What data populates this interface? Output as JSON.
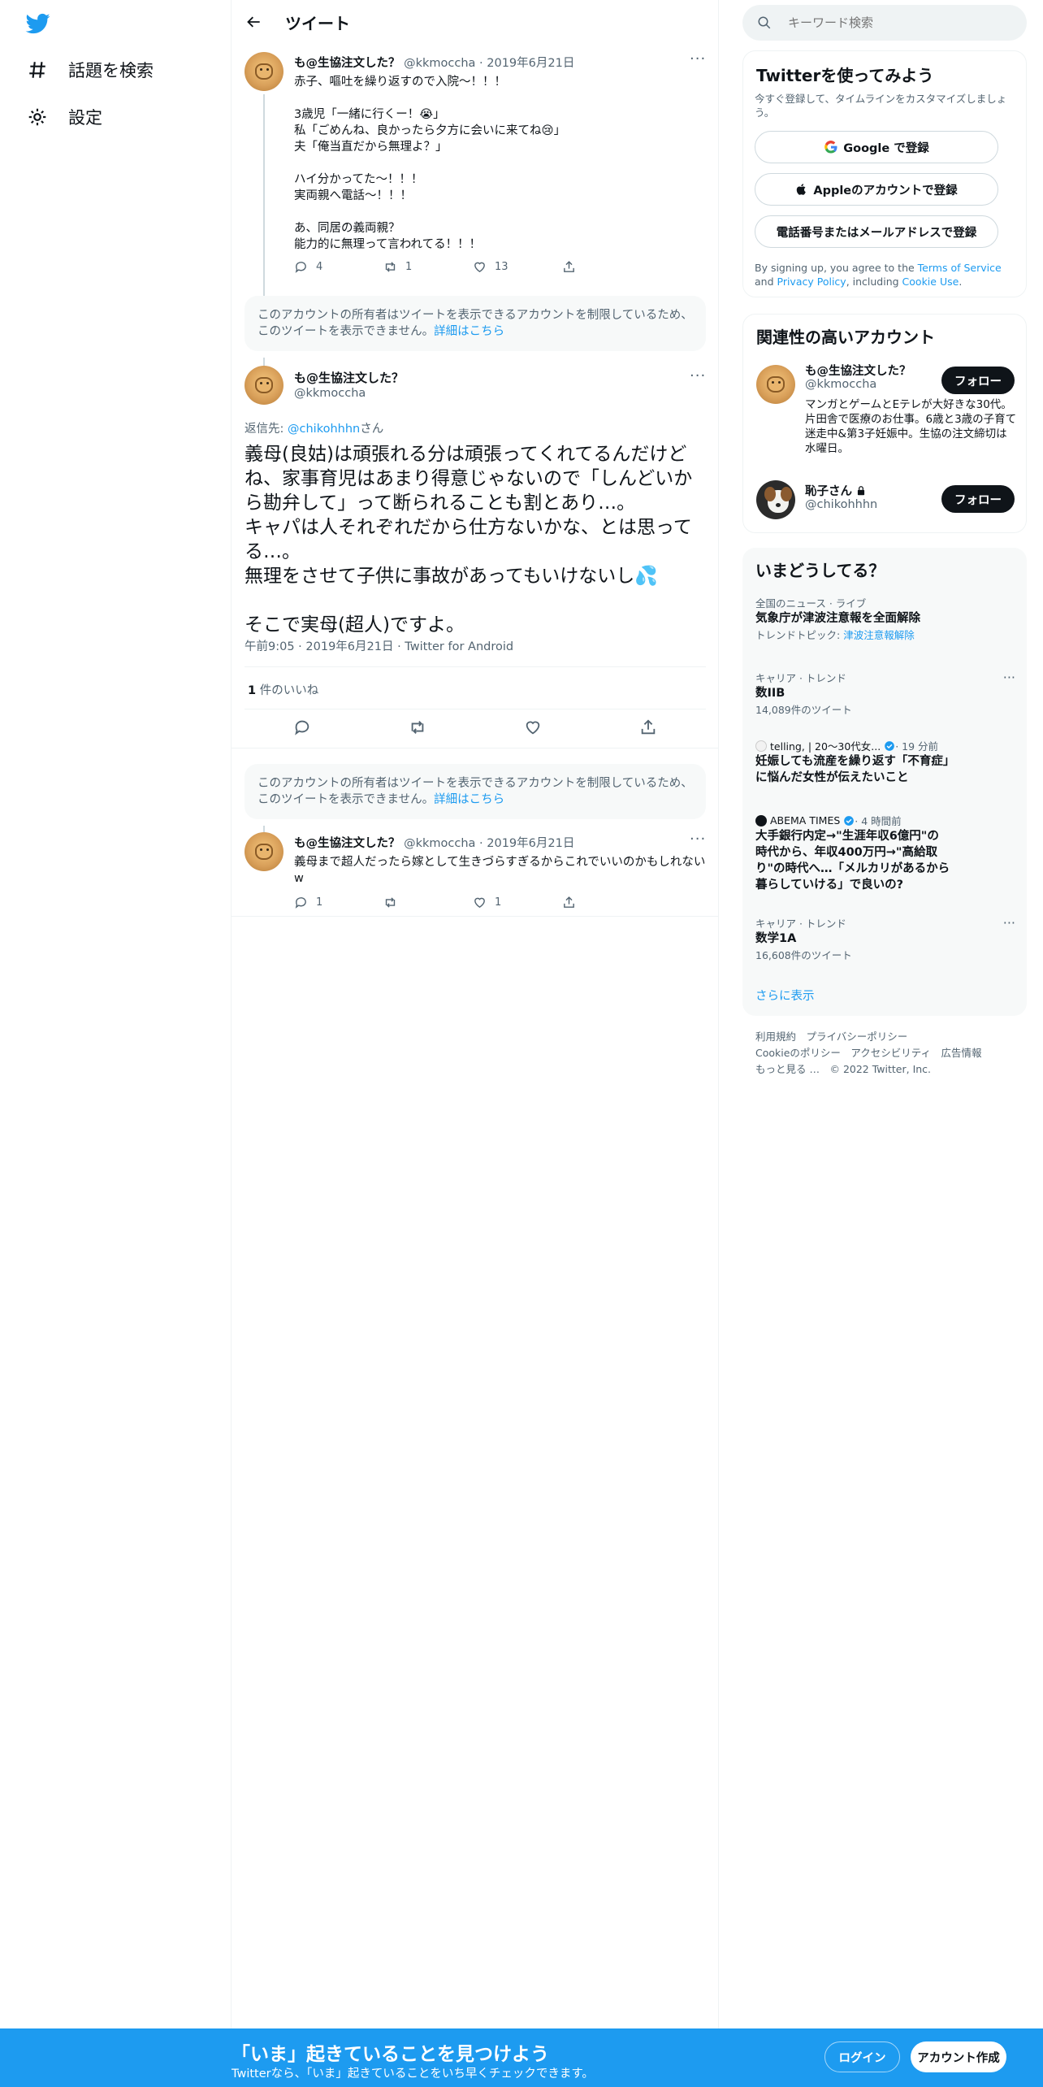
{
  "nav": {
    "explore_label": "話題を検索",
    "settings_label": "設定"
  },
  "header": {
    "title": "ツイート"
  },
  "tweet1": {
    "name": "も@生協注文した？",
    "handle": "@kkmoccha",
    "date": "2019年6月21日",
    "text": "赤子、嘔吐を繰り返すので入院～！！！\n\n3歳児「一緒に行くー！😭」\n私「ごめんね、良かったら夕方に会いに来てね😢」\n夫「俺当直だから無理よ？」\n\nハイ分かってた～！！！\n実両親へ電話～！！！\n\nあ、同居の義両親？\n能力的に無理って言われてる！！！",
    "replies": "4",
    "retweets": "1",
    "likes": "13"
  },
  "restricted_notice": {
    "text": "このアカウントの所有者はツイートを表示できるアカウントを制限しているため、このツイートを表示できません。",
    "link": "詳細はこちら"
  },
  "focus": {
    "name": "も@生協注文した？",
    "handle": "@kkmoccha",
    "reply_prefix": "返信先: ",
    "reply_to": "@chikohhhn",
    "reply_suffix": "さん",
    "text": "義母(良姑)は頑張れる分は頑張ってくれてるんだけどね、家事育児はあまり得意じゃないので「しんどいから勘弁して」って断られることも割とあり…。\nキャパは人それぞれだから仕方ないかな、とは思ってる…。\n無理をさせて子供に事故があってもいけないし💦\n\nそこで実母(超人)ですよ。",
    "meta": "午前9:05 · 2019年6月21日 · Twitter for Android",
    "likes_count": "1",
    "likes_label": " 件のいいね"
  },
  "tweet3": {
    "name": "も@生協注文した？",
    "handle": "@kkmoccha",
    "date": "2019年6月21日",
    "text": "義母まで超人だったら嫁として生きづらすぎるからこれでいいのかもしれないw",
    "replies": "1",
    "retweets": "",
    "likes": "1"
  },
  "search": {
    "placeholder": "キーワード検索"
  },
  "signup_card": {
    "title": "Twitterを使ってみよう",
    "subtitle": "今すぐ登録して、タイムラインをカスタマイズしましょう。",
    "google": "Google で登録",
    "apple": "Appleのアカウントで登録",
    "phone": "電話番号またはメールアドレスで登録",
    "terms_prefix": "By signing up, you agree to the ",
    "terms_link": "Terms of Service",
    "terms_and": " and ",
    "privacy_link": "Privacy Policy",
    "terms_including": ", including ",
    "cookie_link": "Cookie Use",
    "terms_end": "."
  },
  "related": {
    "title": "関連性の高いアカウント",
    "accounts": [
      {
        "name": "も@生協注文した？",
        "handle": "@kkmoccha",
        "bio": "マンガとゲームとEテレが大好きな30代。片田舎で医療のお仕事。6歳と3歳の子育て迷走中&第3子妊娠中。生協の注文締切は水曜日。",
        "follow": "フォロー"
      },
      {
        "name": "恥子さん",
        "handle": "@chikohhhn",
        "follow": "フォロー"
      }
    ]
  },
  "trends": {
    "title": "いまどうしてる？",
    "items": [
      {
        "meta": "全国のニュース · ライブ",
        "title": "気象庁が津波注意報を全面解除",
        "sub_prefix": "トレンドトピック: ",
        "sub_link": "津波注意報解除"
      },
      {
        "meta": "キャリア · トレンド",
        "title": "数IIB",
        "sub": "14,089件のツイート"
      },
      {
        "meta_source": "telling, | 20～30代女...",
        "meta_time": " · 19 分前",
        "title": "妊娠しても流産を繰り返す「不育症」に悩んだ女性が伝えたいこと"
      },
      {
        "meta_source": "ABEMA TIMES",
        "meta_time": " · 4 時間前",
        "title": "大手銀行内定→\"生涯年収6億円\"の時代から、年収400万円→\"高給取り\"の時代へ…「メルカリがあるから暮らしていける」で良いの?"
      },
      {
        "meta": "キャリア · トレンド",
        "title": "数学1A",
        "sub": "16,608件のツイート"
      }
    ],
    "show_more": "さらに表示"
  },
  "footer": {
    "line1": "利用規約　プライバシーポリシー",
    "line2": "Cookieのポリシー　アクセシビリティ　広告情報",
    "line3": "もっと見る …　© 2022 Twitter, Inc."
  },
  "bottom_bar": {
    "title": "「いま」起きていることを見つけよう",
    "subtitle": "Twitterなら、「いま」起きていることをいち早くチェックできます。",
    "login": "ログイン",
    "signup": "アカウント作成"
  },
  "colors": {
    "accent": "#1d9bf0",
    "text": "#0f1419",
    "muted": "#536471",
    "border": "#eff3f4"
  }
}
